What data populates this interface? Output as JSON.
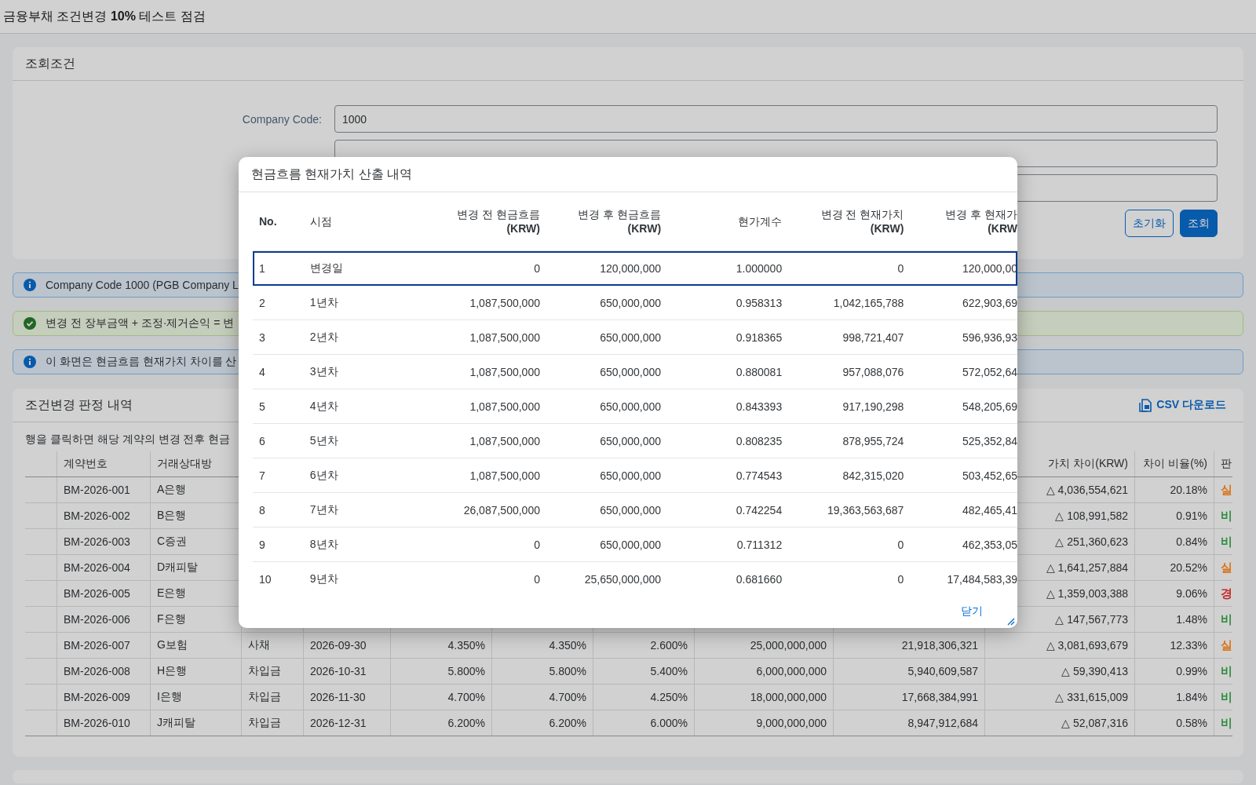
{
  "page_title": "금융부채 조건변경 **10%** 테스트 점검",
  "filters": {
    "title": "조회조건",
    "fields": [
      {
        "kind": "text",
        "label": "Company Code:",
        "value": "1000"
      },
      {
        "kind": "text"
      },
      {
        "kind": "text"
      }
    ],
    "buttons": [
      {
        "label": "초기화",
        "kind": "secondary"
      },
      {
        "label": "조회",
        "kind": "primary"
      }
    ]
  },
  "messages": [
    {
      "kind": "info",
      "text": "Company Code 1000 (PGB Company L"
    },
    {
      "kind": "success",
      "text": "변경 전 장부금액 + 조정·제거손익 = 변"
    },
    {
      "kind": "info",
      "text": "이 화면은 현금흐름 현재가치 차이를 산"
    }
  ],
  "results": {
    "title": "조건변경 판정 내역",
    "csv_button": "CSV 다운로드",
    "hint": "행을 클릭하면 해당 계약의 변경 전후 현금",
    "columns": {
      "contract": "계약번호",
      "counterparty": "거래상대방",
      "diff": "가치 차이(KRW)",
      "ratio": "차이 비율(%)",
      "judgement": "판"
    },
    "rows": [
      {
        "contract": "BM-2026-001",
        "counterparty": "A은행",
        "diff": "△ 4,036,554,621",
        "ratio": "20.18%",
        "judgement": "실",
        "color": "#d9731a"
      },
      {
        "contract": "BM-2026-002",
        "counterparty": "B은행",
        "diff": "△ 108,991,582",
        "ratio": "0.91%",
        "judgement": "비",
        "color": "#2e8b3d"
      },
      {
        "contract": "BM-2026-003",
        "counterparty": "C증권",
        "diff": "△ 251,360,623",
        "ratio": "0.84%",
        "judgement": "비",
        "color": "#2e8b3d"
      },
      {
        "contract": "BM-2026-004",
        "counterparty": "D캐피탈",
        "diff": "△ 1,641,257,884",
        "ratio": "20.52%",
        "judgement": "실",
        "color": "#d9731a"
      },
      {
        "contract": "BM-2026-005",
        "counterparty": "E은행",
        "diff": "△ 1,359,003,388",
        "ratio": "9.06%",
        "judgement": "경",
        "color": "#c62828"
      },
      {
        "contract": "BM-2026-006",
        "counterparty": "F은행",
        "diff": "△ 147,567,773",
        "ratio": "1.48%",
        "judgement": "비",
        "color": "#2e8b3d"
      },
      {
        "contract": "BM-2026-007",
        "counterparty": "G보험",
        "type": "사채",
        "date": "2026-09-30",
        "rate_1": "4.350%",
        "rate_2": "4.350%",
        "rate_3": "2.600%",
        "amount_1": "25,000,000,000",
        "amount_2": "21,918,306,321",
        "diff": "△ 3,081,693,679",
        "ratio": "12.33%",
        "judgement": "실",
        "color": "#d9731a"
      },
      {
        "contract": "BM-2026-008",
        "counterparty": "H은행",
        "type": "차입금",
        "date": "2026-10-31",
        "rate_1": "5.800%",
        "rate_2": "5.800%",
        "rate_3": "5.400%",
        "amount_1": "6,000,000,000",
        "amount_2": "5,940,609,587",
        "diff": "△ 59,390,413",
        "ratio": "0.99%",
        "judgement": "비",
        "color": "#2e8b3d"
      },
      {
        "contract": "BM-2026-009",
        "counterparty": "I은행",
        "type": "차입금",
        "date": "2026-11-30",
        "rate_1": "4.700%",
        "rate_2": "4.700%",
        "rate_3": "4.250%",
        "amount_1": "18,000,000,000",
        "amount_2": "17,668,384,991",
        "diff": "△ 331,615,009",
        "ratio": "1.84%",
        "judgement": "비",
        "color": "#2e8b3d"
      },
      {
        "contract": "BM-2026-010",
        "counterparty": "J캐피탈",
        "type": "차입금",
        "date": "2026-12-31",
        "rate_1": "6.200%",
        "rate_2": "6.200%",
        "rate_3": "6.000%",
        "amount_1": "9,000,000,000",
        "amount_2": "8,947,912,684",
        "diff": "△ 52,087,316",
        "ratio": "0.58%",
        "judgement": "비",
        "color": "#2e8b3d"
      }
    ]
  },
  "dialog": {
    "title": "현금흐름 현재가치 산출 내역",
    "columns": [
      {
        "label": "No."
      },
      {
        "label": "시점"
      },
      {
        "label": "변경 전 현금흐름",
        "unit": "(KRW)"
      },
      {
        "label": "변경 후 현금흐름",
        "unit": "(KRW)"
      },
      {
        "label": "현가계수"
      },
      {
        "label": "변경 전 현재가치",
        "unit": "(KRW)"
      },
      {
        "label": "변경 후 현재가",
        "unit": "(KRW"
      }
    ],
    "rows": [
      {
        "selected": true,
        "cells": [
          "1",
          "변경일",
          "0",
          "120,000,000",
          "1.000000",
          "0",
          "120,000,00"
        ]
      },
      {
        "selected": false,
        "cells": [
          "2",
          "1년차",
          "1,087,500,000",
          "650,000,000",
          "0.958313",
          "1,042,165,788",
          "622,903,69"
        ]
      },
      {
        "selected": false,
        "cells": [
          "3",
          "2년차",
          "1,087,500,000",
          "650,000,000",
          "0.918365",
          "998,721,407",
          "596,936,93"
        ]
      },
      {
        "selected": false,
        "cells": [
          "4",
          "3년차",
          "1,087,500,000",
          "650,000,000",
          "0.880081",
          "957,088,076",
          "572,052,64"
        ]
      },
      {
        "selected": false,
        "cells": [
          "5",
          "4년차",
          "1,087,500,000",
          "650,000,000",
          "0.843393",
          "917,190,298",
          "548,205,69"
        ]
      },
      {
        "selected": false,
        "cells": [
          "6",
          "5년차",
          "1,087,500,000",
          "650,000,000",
          "0.808235",
          "878,955,724",
          "525,352,84"
        ]
      },
      {
        "selected": false,
        "cells": [
          "7",
          "6년차",
          "1,087,500,000",
          "650,000,000",
          "0.774543",
          "842,315,020",
          "503,452,65"
        ]
      },
      {
        "selected": false,
        "cells": [
          "8",
          "7년차",
          "26,087,500,000",
          "650,000,000",
          "0.742254",
          "19,363,563,687",
          "482,465,41"
        ]
      },
      {
        "selected": false,
        "cells": [
          "9",
          "8년차",
          "0",
          "650,000,000",
          "0.711312",
          "0",
          "462,353,05"
        ]
      },
      {
        "selected": false,
        "cells": [
          "10",
          "9년차",
          "0",
          "25,650,000,000",
          "0.681660",
          "0",
          "17,484,583,39"
        ]
      }
    ],
    "close_button": "닫기"
  }
}
